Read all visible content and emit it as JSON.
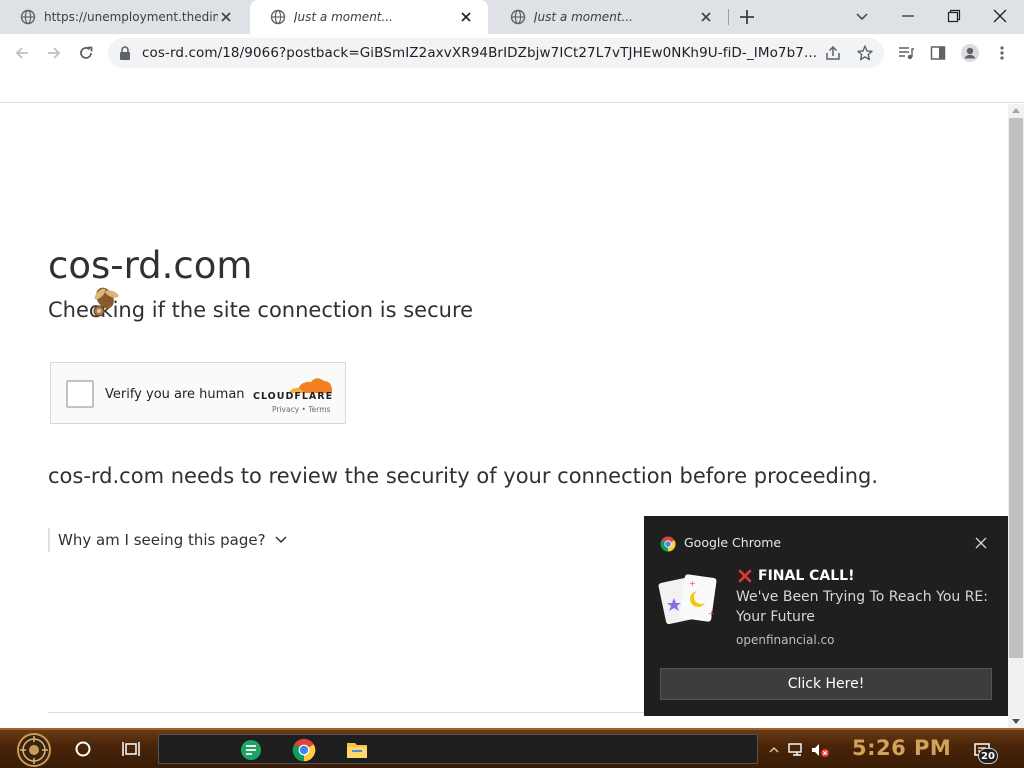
{
  "tabs": [
    {
      "title": "https://unemployment.thedime",
      "active": false
    },
    {
      "title": "Just a moment...",
      "active": true
    },
    {
      "title": "Just a moment...",
      "active": false
    }
  ],
  "toolbar": {
    "url": "cos-rd.com/18/9066?postback=GiBSmIZ2axvXR94BrIDZbjw7ICt27L7vTJHEw0NKh9U-fiD-_IMo7b7..."
  },
  "page": {
    "site_name": "cos-rd.com",
    "subtitle": "Checking if the site connection is secure",
    "widget": {
      "label": "Verify you are human",
      "brand": "CLOUDFLARE",
      "privacy": "Privacy",
      "dot": "•",
      "terms": "Terms",
      "accent_color": "#f38020"
    },
    "review_text": "cos-rd.com needs to review the security of your connection before proceeding.",
    "why_text": "Why am I seeing this page?"
  },
  "notification": {
    "app_name": "Google Chrome",
    "title": "FINAL CALL!",
    "body": "We've Been Trying To Reach You RE: Your Future",
    "source": "openfinancial.co",
    "action_label": "Click Here!"
  },
  "taskbar": {
    "clock": "5:26 PM",
    "notification_count": "20"
  },
  "icons": [
    "globe-icon",
    "close-icon",
    "plus-icon",
    "chevron-down-icon",
    "minimize-icon",
    "maximize-icon",
    "back-icon",
    "forward-icon",
    "reload-icon",
    "lock-icon",
    "share-icon",
    "star-icon",
    "media-icon",
    "side-panel-icon",
    "profile-icon",
    "menu-icon",
    "chrome-icon",
    "cards-icon",
    "cross-icon"
  ]
}
